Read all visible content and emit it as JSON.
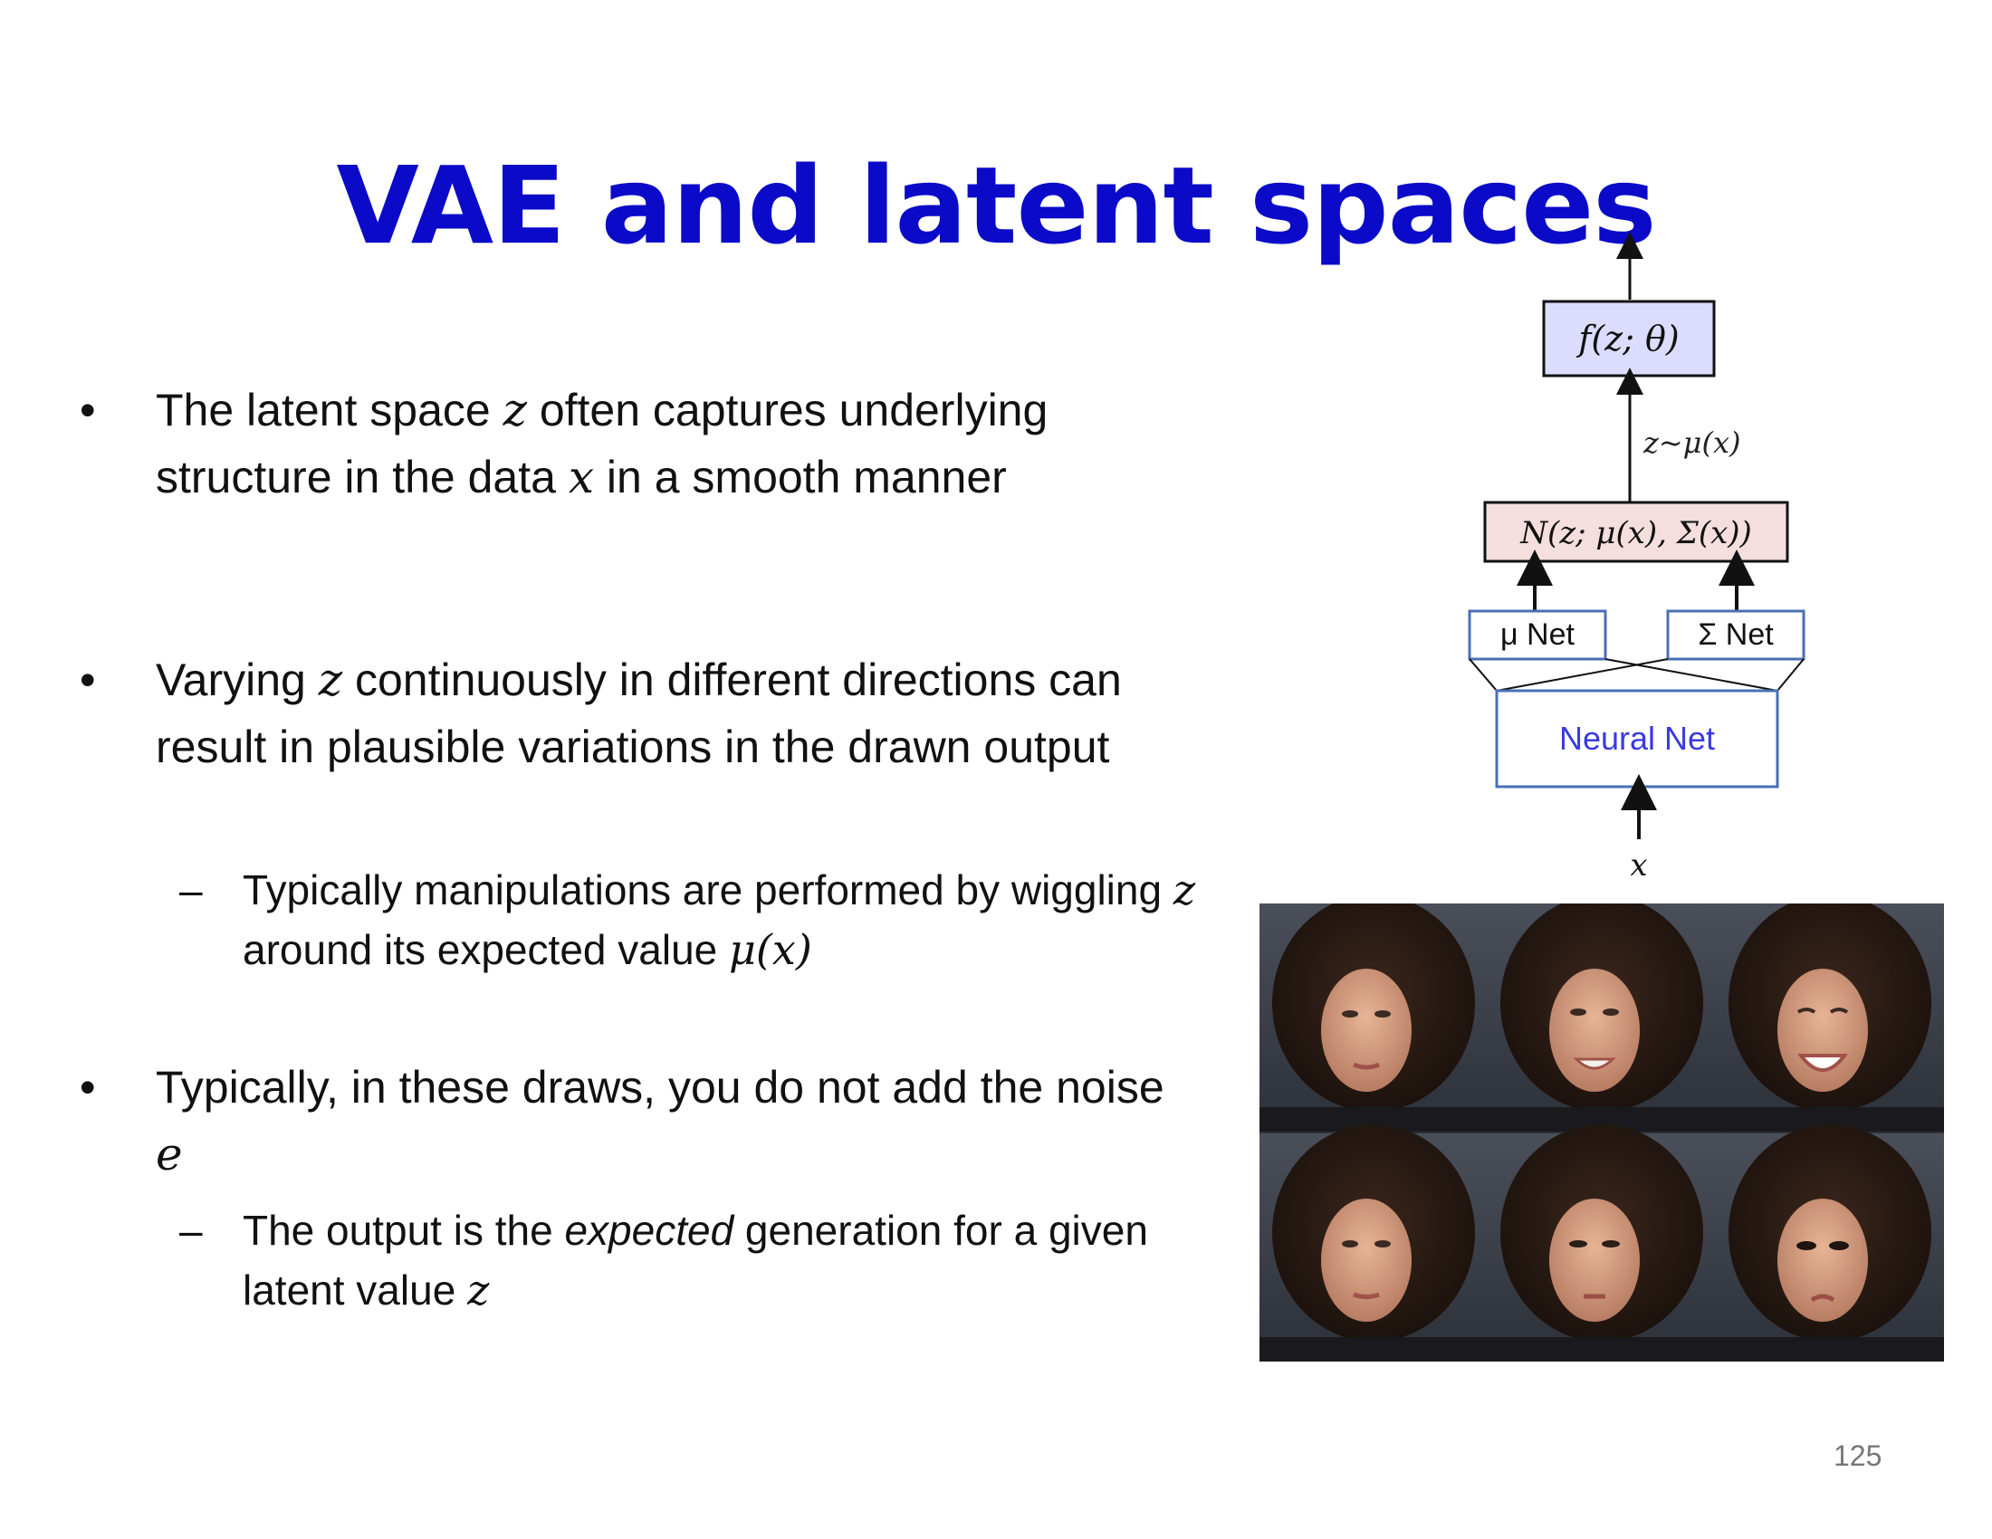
{
  "slide": {
    "title": "VAE and latent spaces",
    "page_number": "125",
    "bullets": [
      {
        "parts": [
          "The latent space ",
          "z",
          " often captures underlying structure in the data ",
          "x",
          " in a smooth manner"
        ]
      },
      {
        "parts": [
          "Varying ",
          "z",
          " continuously in different directions can result in plausible variations in the drawn output"
        ]
      },
      {
        "parts": [
          "Typically, in these draws, you do not add the noise ",
          "e"
        ]
      }
    ],
    "subbullets": [
      {
        "parts": [
          "Typically manipulations are performed by wiggling ",
          "z",
          " around its expected value ",
          "μ(x)"
        ]
      },
      {
        "parts": [
          "The output is the ",
          "expected",
          " generation for a given latent value ",
          "z"
        ]
      }
    ]
  },
  "diagram": {
    "decoder_box": "f(z; θ)",
    "sample_label": "z~μ(x)",
    "gaussian_box": "N(z; μ(x), Σ(x))",
    "mu_net": "μ Net",
    "sigma_net": "Σ Net",
    "neural_net": "Neural Net",
    "input_label": "x",
    "colors": {
      "decoder_fill": "#dcdcff",
      "gaussian_fill": "#f4dede",
      "net_border": "#4a6fb5",
      "neural_net_text": "#3a3ae0"
    }
  },
  "faces_grid": {
    "rows": 2,
    "cols": 3,
    "description_icons": [
      "face-neutral",
      "face-smile",
      "face-big-smile",
      "face-neutral-2",
      "face-serious",
      "face-frown"
    ]
  }
}
